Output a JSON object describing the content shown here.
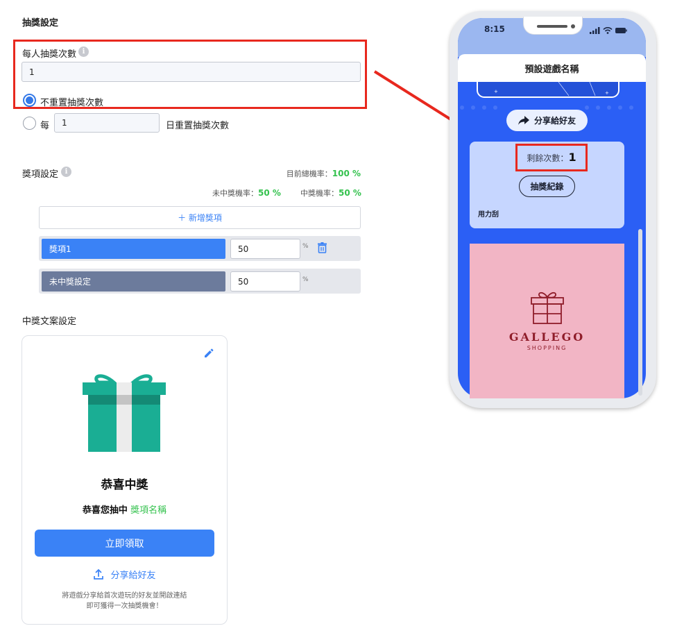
{
  "settings": {
    "section_title": "抽獎設定",
    "per_person_label": "每人抽獎次數",
    "info_glyph": "i",
    "per_person_value": "1",
    "radio_no_reset_label": "不重置抽獎次數",
    "radio_every_label": "每",
    "reset_days_value": "1",
    "radio_reset_suffix": "日重置抽獎次數",
    "highlight_color": "#e8281e"
  },
  "prizes": {
    "section_title": "獎項設定",
    "total_rate_label": "目前總機率：",
    "total_rate_value": "100 %",
    "lose_rate_label": "未中獎機率：",
    "lose_rate_value": "50 %",
    "win_rate_label": "中獎機率：",
    "win_rate_value": "50 %",
    "add_button_label": "＋ 新增獎項",
    "items": [
      {
        "name": "獎項1",
        "value": "50",
        "unit": "%",
        "color": "#3a82f6"
      },
      {
        "name": "未中獎設定",
        "value": "50",
        "unit": "%",
        "color": "#6c7b9c"
      }
    ]
  },
  "win_text": {
    "section_title": "中獎文案設定",
    "title": "恭喜中獎",
    "subtitle_prefix": "恭喜您抽中",
    "subtitle_prize": "獎項名稱",
    "claim_button_label": "立即領取",
    "share_link_label": "分享給好友",
    "footnote_line1": "將遊戲分享給首次遊玩的好友並開啟連結",
    "footnote_line2": "即可獲得一次抽獎機會！",
    "gift_color": "#1aae94"
  },
  "phone": {
    "time": "8:15",
    "game_title": "預設遊戲名稱",
    "share_button_label": "分享給好友",
    "remaining_label": "剩餘次數：",
    "remaining_value": "1",
    "history_button_label": "抽獎紀錄",
    "scratch_label": "用力刮",
    "brand_name": "GALLEGO",
    "brand_tagline": "SHOPPING",
    "brand_bg_color": "#f2b5c5",
    "brand_color": "#8f1d2a",
    "screen_color": "#2b5ff5"
  }
}
